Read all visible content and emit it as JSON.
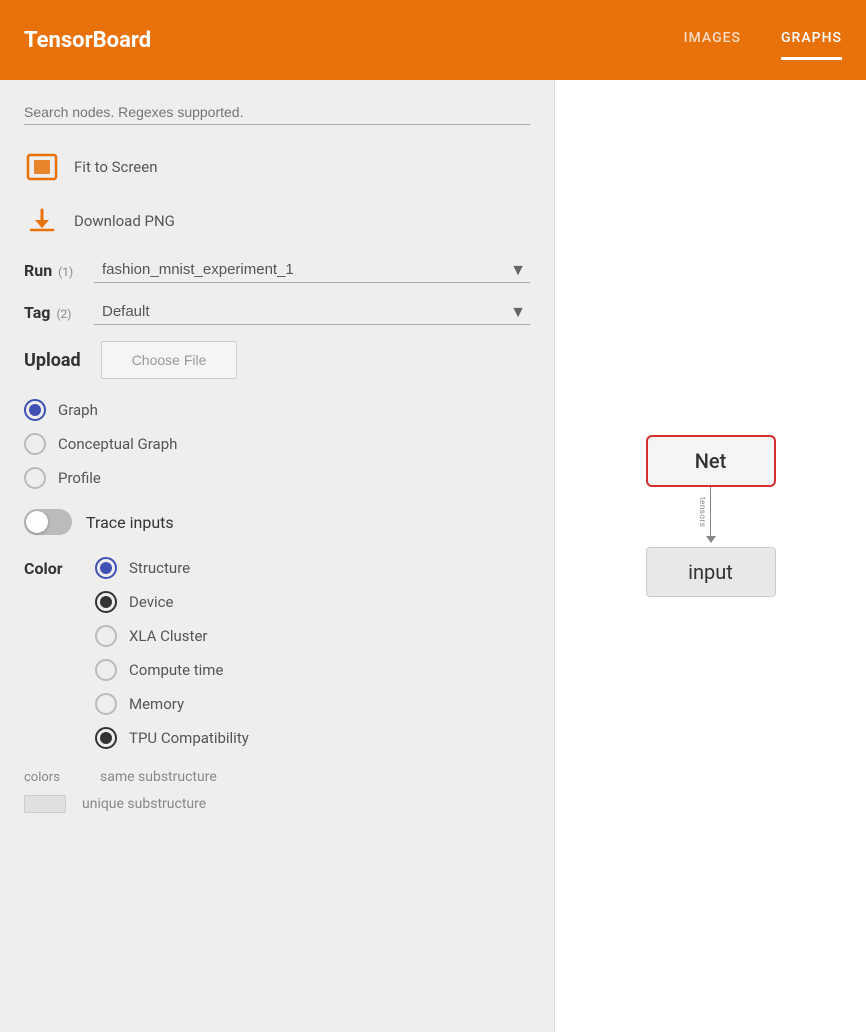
{
  "header": {
    "title": "TensorBoard",
    "nav": [
      {
        "label": "IMAGES",
        "active": false
      },
      {
        "label": "GRAPHS",
        "active": true
      }
    ]
  },
  "sidebar": {
    "search": {
      "placeholder": "Search nodes. Regexes supported.",
      "value": ""
    },
    "actions": [
      {
        "id": "fit-to-screen",
        "label": "Fit to Screen"
      },
      {
        "id": "download-png",
        "label": "Download PNG"
      }
    ],
    "run": {
      "label": "Run",
      "sub": "(1)",
      "value": "fashion_mnist_experiment_1"
    },
    "tag": {
      "label": "Tag",
      "sub": "(2)",
      "value": "Default"
    },
    "upload": {
      "label": "Upload",
      "button": "Choose File"
    },
    "graph_type": {
      "options": [
        {
          "label": "Graph",
          "selected": true
        },
        {
          "label": "Conceptual Graph",
          "selected": false
        },
        {
          "label": "Profile",
          "selected": false
        }
      ]
    },
    "trace_inputs": {
      "label": "Trace inputs",
      "enabled": false
    },
    "color": {
      "label": "Color",
      "options": [
        {
          "label": "Structure",
          "selected": true,
          "style": "blue"
        },
        {
          "label": "Device",
          "selected": false,
          "style": "dark"
        },
        {
          "label": "XLA Cluster",
          "selected": false,
          "style": "none"
        },
        {
          "label": "Compute time",
          "selected": false,
          "style": "none"
        },
        {
          "label": "Memory",
          "selected": false,
          "style": "none"
        },
        {
          "label": "TPU Compatibility",
          "selected": false,
          "style": "dark"
        }
      ]
    },
    "legend": {
      "label": "colors",
      "items": [
        {
          "swatch": true,
          "text": "same substructure"
        },
        {
          "swatch": true,
          "text": "unique substructure"
        }
      ]
    }
  },
  "graph": {
    "net_label": "Net",
    "input_label": "input",
    "connector_text": "tensors"
  }
}
